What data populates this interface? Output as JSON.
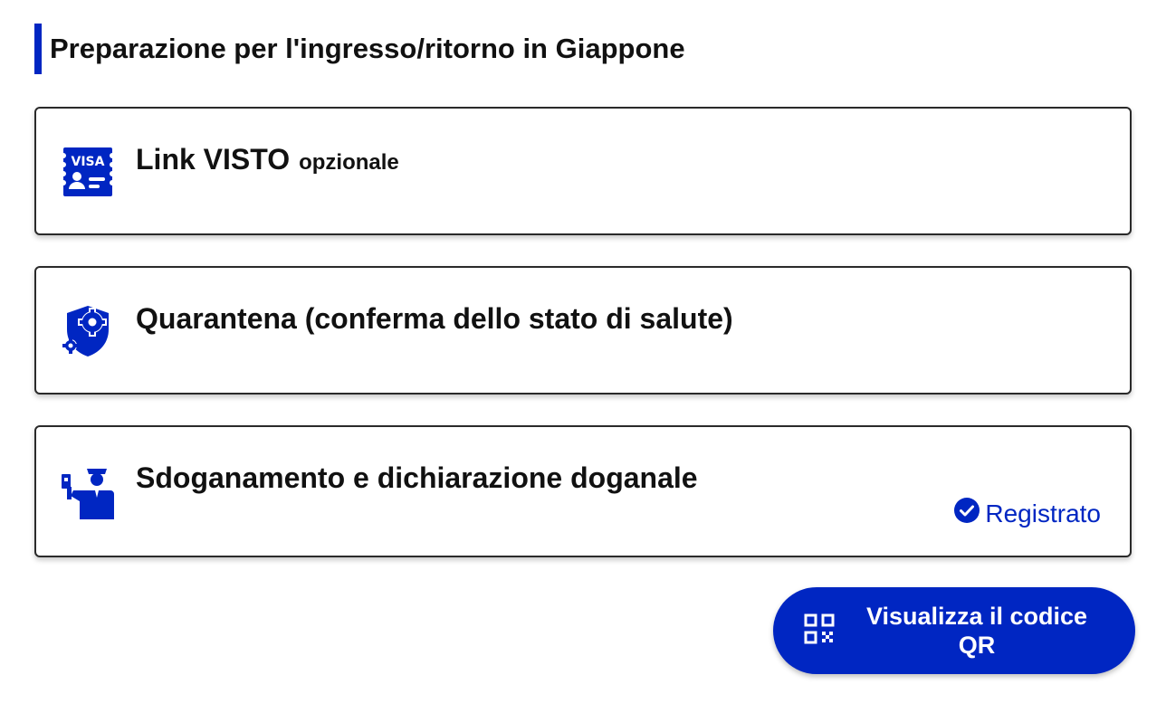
{
  "section": {
    "title": "Preparazione per l'ingresso/ritorno in Giappone"
  },
  "cards": [
    {
      "label": "Link VISTO",
      "optional_label": "opzionale",
      "icon": "visa-card-icon"
    },
    {
      "label": "Quarantena (conferma dello stato di salute)",
      "icon": "health-shield-gear-icon"
    },
    {
      "label": "Sdoganamento e dichiarazione doganale",
      "icon": "customs-officer-icon",
      "status": "Registrato",
      "status_icon": "check-circle-icon"
    }
  ],
  "qr_button": {
    "label": "Visualizza il codice QR",
    "icon": "qr-code-icon"
  },
  "colors": {
    "accent": "#0026c2",
    "text": "#111111",
    "border": "#2a2a2a",
    "background": "#ffffff"
  }
}
